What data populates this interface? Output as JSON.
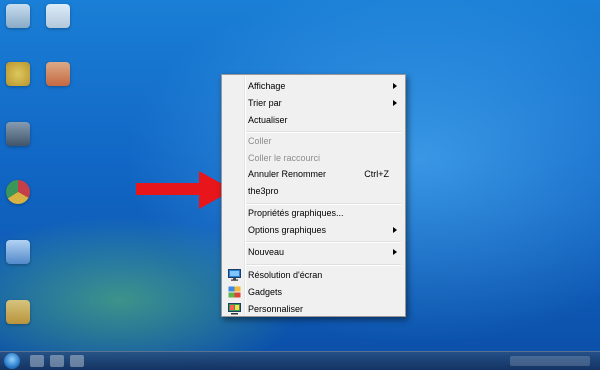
{
  "menu": {
    "items": [
      {
        "label": "Affichage",
        "submenu": true
      },
      {
        "label": "Trier par",
        "submenu": true
      },
      {
        "label": "Actualiser"
      },
      {
        "label": "Coller",
        "disabled": true
      },
      {
        "label": "Coller le raccourci",
        "disabled": true
      },
      {
        "label": "Annuler Renommer",
        "shortcut": "Ctrl+Z"
      },
      {
        "label": "the3pro"
      },
      {
        "label": "Propriétés graphiques..."
      },
      {
        "label": "Options graphiques",
        "submenu": true
      },
      {
        "label": "Nouveau",
        "submenu": true
      },
      {
        "label": "Résolution d'écran",
        "icon": "monitor-icon"
      },
      {
        "label": "Gadgets",
        "icon": "gadgets-icon"
      },
      {
        "label": "Personnaliser",
        "icon": "personalize-icon"
      }
    ]
  },
  "annotation": {
    "arrow": "red-arrow-pointing-right",
    "color": "#e8151b"
  },
  "colors": {
    "menu_background": "#f0f0f0",
    "menu_border": "#979797",
    "disabled_text": "#8d8d8d",
    "desktop_blue": "#1166c4"
  }
}
